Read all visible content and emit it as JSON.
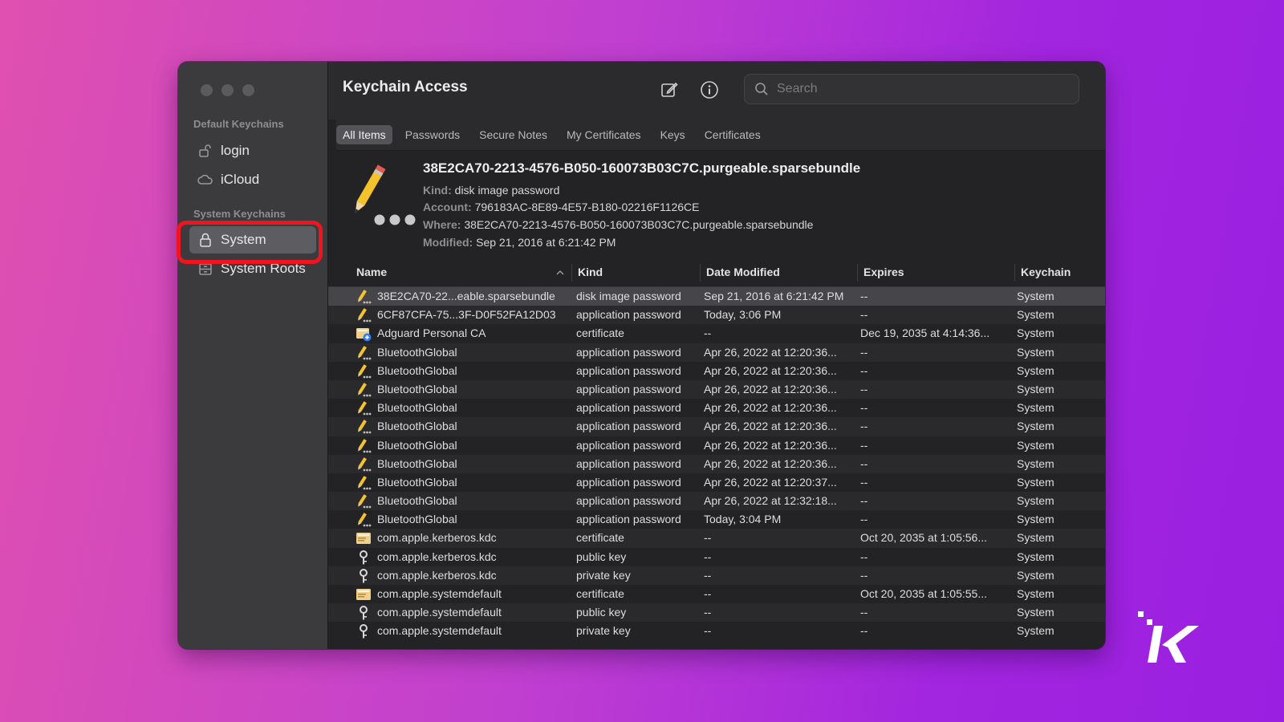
{
  "window": {
    "title": "Keychain Access",
    "search": {
      "placeholder": "Search",
      "value": ""
    }
  },
  "sidebar": {
    "sections": [
      {
        "heading": "Default Keychains",
        "items": [
          {
            "label": "login",
            "icon": "unlock-icon"
          },
          {
            "label": "iCloud",
            "icon": "cloud-icon"
          }
        ]
      },
      {
        "heading": "System Keychains",
        "items": [
          {
            "label": "System",
            "icon": "lock-icon",
            "selected": true
          },
          {
            "label": "System Roots",
            "icon": "cabinet-icon"
          }
        ]
      }
    ]
  },
  "tabs": [
    "All Items",
    "Passwords",
    "Secure Notes",
    "My Certificates",
    "Keys",
    "Certificates"
  ],
  "active_tab": "All Items",
  "detail": {
    "name": "38E2CA70-2213-4576-B050-160073B03C7C.purgeable.sparsebundle",
    "kind_label": "Kind:",
    "kind": "disk image password",
    "account_label": "Account:",
    "account": "796183AC-8E89-4E57-B180-02216F1126CE",
    "where_label": "Where:",
    "where": "38E2CA70-2213-4576-B050-160073B03C7C.purgeable.sparsebundle",
    "modified_label": "Modified:",
    "modified": "Sep 21, 2016 at 6:21:42 PM"
  },
  "table": {
    "columns": [
      "Name",
      "Kind",
      "Date Modified",
      "Expires",
      "Keychain"
    ],
    "rows": [
      {
        "icon": "password-icon",
        "name": "38E2CA70-22...eable.sparsebundle",
        "kind": "disk image password",
        "date": "Sep 21, 2016 at 6:21:42 PM",
        "expires": "--",
        "keychain": "System",
        "selected": true
      },
      {
        "icon": "password-icon",
        "name": "6CF87CFA-75...3F-D0F52FA12D03",
        "kind": "application password",
        "date": "Today, 3:06 PM",
        "expires": "--",
        "keychain": "System"
      },
      {
        "icon": "certificate-plus-icon",
        "name": "Adguard Personal CA",
        "kind": "certificate",
        "date": "--",
        "expires": "Dec 19, 2035 at 4:14:36...",
        "keychain": "System"
      },
      {
        "icon": "password-icon",
        "name": "BluetoothGlobal",
        "kind": "application password",
        "date": "Apr 26, 2022 at 12:20:36...",
        "expires": "--",
        "keychain": "System"
      },
      {
        "icon": "password-icon",
        "name": "BluetoothGlobal",
        "kind": "application password",
        "date": "Apr 26, 2022 at 12:20:36...",
        "expires": "--",
        "keychain": "System"
      },
      {
        "icon": "password-icon",
        "name": "BluetoothGlobal",
        "kind": "application password",
        "date": "Apr 26, 2022 at 12:20:36...",
        "expires": "--",
        "keychain": "System"
      },
      {
        "icon": "password-icon",
        "name": "BluetoothGlobal",
        "kind": "application password",
        "date": "Apr 26, 2022 at 12:20:36...",
        "expires": "--",
        "keychain": "System"
      },
      {
        "icon": "password-icon",
        "name": "BluetoothGlobal",
        "kind": "application password",
        "date": "Apr 26, 2022 at 12:20:36...",
        "expires": "--",
        "keychain": "System"
      },
      {
        "icon": "password-icon",
        "name": "BluetoothGlobal",
        "kind": "application password",
        "date": "Apr 26, 2022 at 12:20:36...",
        "expires": "--",
        "keychain": "System"
      },
      {
        "icon": "password-icon",
        "name": "BluetoothGlobal",
        "kind": "application password",
        "date": "Apr 26, 2022 at 12:20:36...",
        "expires": "--",
        "keychain": "System"
      },
      {
        "icon": "password-icon",
        "name": "BluetoothGlobal",
        "kind": "application password",
        "date": "Apr 26, 2022 at 12:20:37...",
        "expires": "--",
        "keychain": "System"
      },
      {
        "icon": "password-icon",
        "name": "BluetoothGlobal",
        "kind": "application password",
        "date": "Apr 26, 2022 at 12:32:18...",
        "expires": "--",
        "keychain": "System"
      },
      {
        "icon": "password-icon",
        "name": "BluetoothGlobal",
        "kind": "application password",
        "date": "Today, 3:04 PM",
        "expires": "--",
        "keychain": "System"
      },
      {
        "icon": "certificate-icon",
        "name": "com.apple.kerberos.kdc",
        "kind": "certificate",
        "date": "--",
        "expires": "Oct 20, 2035 at 1:05:56...",
        "keychain": "System"
      },
      {
        "icon": "key-icon",
        "name": "com.apple.kerberos.kdc",
        "kind": "public key",
        "date": "--",
        "expires": "--",
        "keychain": "System"
      },
      {
        "icon": "key-icon",
        "name": "com.apple.kerberos.kdc",
        "kind": "private key",
        "date": "--",
        "expires": "--",
        "keychain": "System"
      },
      {
        "icon": "certificate-icon",
        "name": "com.apple.systemdefault",
        "kind": "certificate",
        "date": "--",
        "expires": "Oct 20, 2035 at 1:05:55...",
        "keychain": "System"
      },
      {
        "icon": "key-icon",
        "name": "com.apple.systemdefault",
        "kind": "public key",
        "date": "--",
        "expires": "--",
        "keychain": "System"
      },
      {
        "icon": "key-icon",
        "name": "com.apple.systemdefault",
        "kind": "private key",
        "date": "--",
        "expires": "--",
        "keychain": "System"
      }
    ]
  },
  "colors": {
    "highlight_ring": "#f0141e",
    "background_start": "#e050b0",
    "background_end": "#9a1fe0"
  },
  "watermark": {
    "icon": "knowtechie-k-logo"
  }
}
